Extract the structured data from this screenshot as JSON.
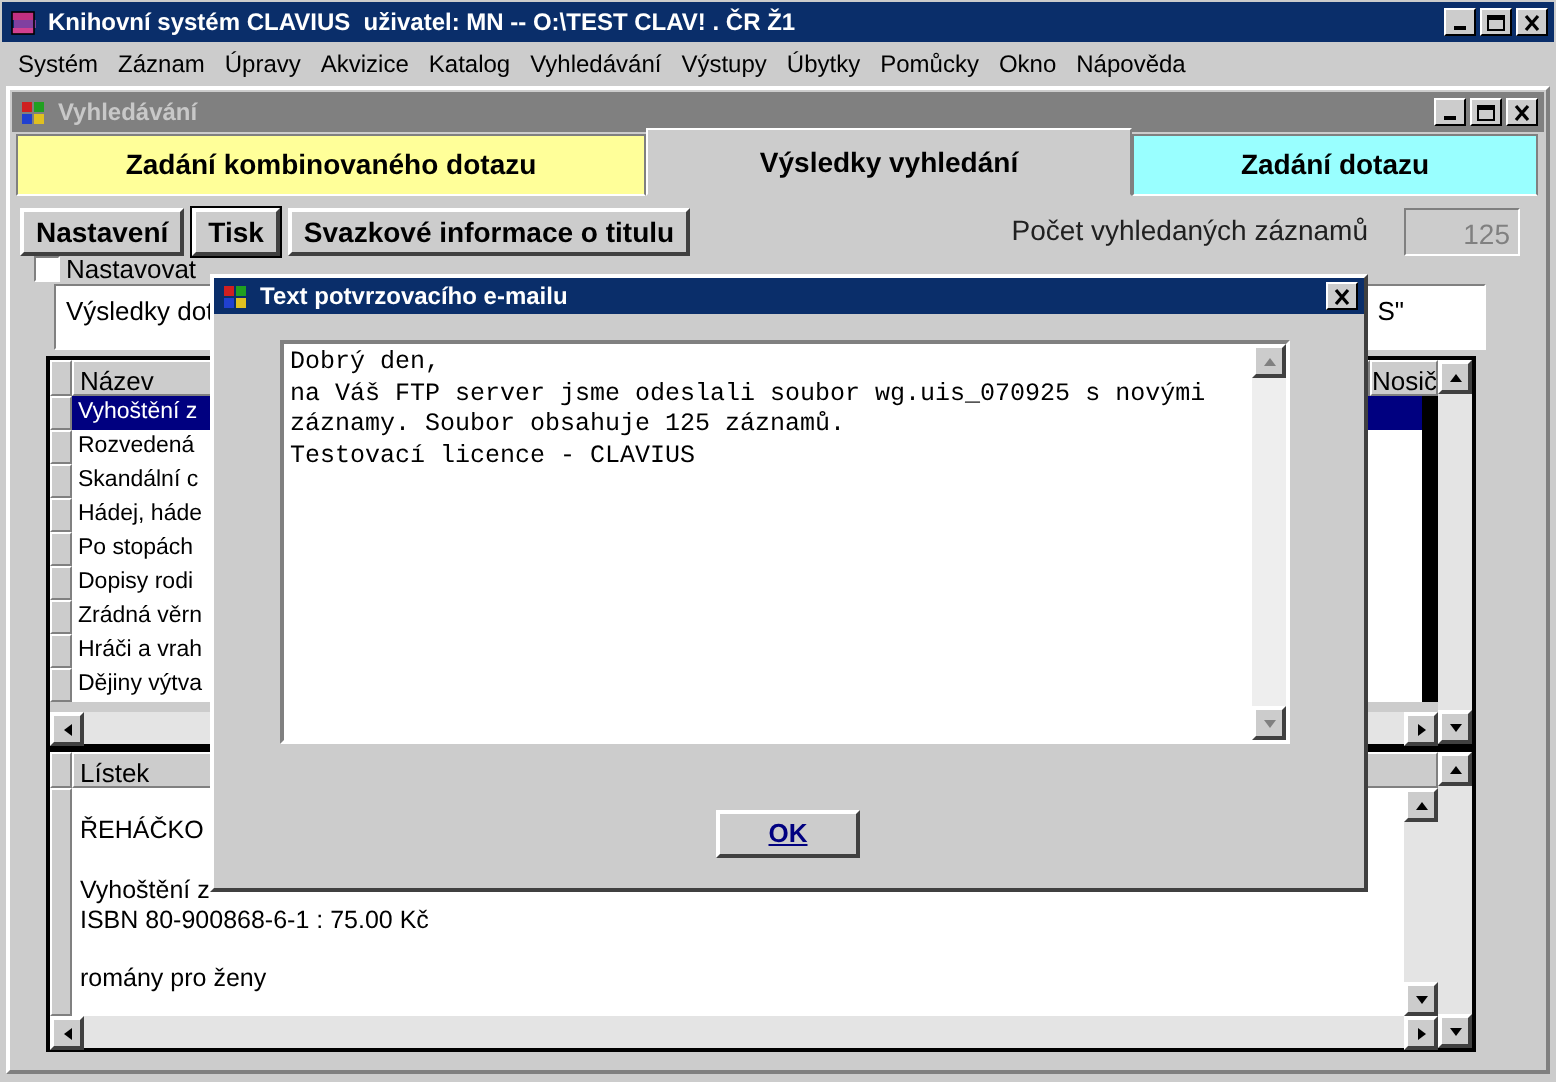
{
  "app_window": {
    "title": "Knihovní systém CLAVIUS  uživatel: MN -- O:\\TEST CLAV! . ČR Ž1"
  },
  "menu": [
    "Systém",
    "Záznam",
    "Úpravy",
    "Akvizice",
    "Katalog",
    "Vyhledávání",
    "Výstupy",
    "Úbytky",
    "Pomůcky",
    "Okno",
    "Nápověda"
  ],
  "child_window": {
    "title": "Vyhledávání"
  },
  "tabs": [
    {
      "label": "Zadání kombinovaného dotazu",
      "selected": false,
      "color": "#ffff99"
    },
    {
      "label": "Výsledky vyhledání",
      "selected": true,
      "color": "#cccccc"
    },
    {
      "label": "Zadání dotazu",
      "selected": false,
      "color": "#99ffff"
    }
  ],
  "toolbar": {
    "buttons": [
      {
        "label": "Nastavení",
        "selected": false
      },
      {
        "label": "Tisk",
        "selected": true
      },
      {
        "label": "Svazkové informace o titulu",
        "selected": false
      }
    ],
    "count_label": "Počet vyhledaných záznamů",
    "count_value": "125"
  },
  "checkbox": {
    "label": "Nastavovat",
    "checked": false
  },
  "query_summary": {
    "text_left": "Výsledky dot",
    "text_right": "S\""
  },
  "results_table": {
    "columns": [
      "Název",
      "Nosič"
    ],
    "rows": [
      {
        "title": "Vyhoštění z",
        "selected": true
      },
      {
        "title": "Rozvedená",
        "selected": false
      },
      {
        "title": "Skandální c",
        "selected": false
      },
      {
        "title": "Hádej, háde",
        "selected": false
      },
      {
        "title": "Po stopách",
        "selected": false
      },
      {
        "title": "Dopisy rodi",
        "selected": false
      },
      {
        "title": "Zrádná věrn",
        "selected": false
      },
      {
        "title": "Hráči a vrah",
        "selected": false
      },
      {
        "title": "Dějiny výtva",
        "selected": false
      }
    ]
  },
  "card_panel": {
    "heading": "Lístek",
    "paragraphs": [
      [
        "ŘEHÁČKO"
      ],
      [
        "Vyhoštění z",
        "ISBN 80-900868-6-1 : 75.00 Kč"
      ],
      [
        "romány pro ženy"
      ]
    ]
  },
  "dialog": {
    "title": "Text potvrzovacího e-mailu",
    "body": "Dobrý den,\nna Váš FTP server jsme odeslali soubor wg.uis_070925 s novými\nzáznamy. Soubor obsahuje 125 záznamů.\nTestovací licence - CLAVIUS",
    "ok_button": "OK"
  }
}
